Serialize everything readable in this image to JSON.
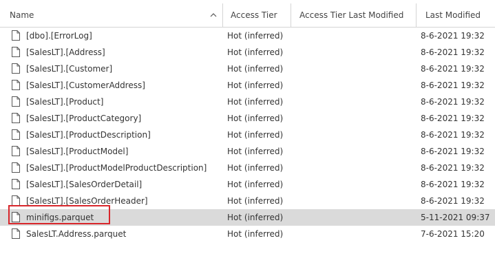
{
  "header": {
    "name": "Name",
    "access_tier": "Access Tier",
    "access_tier_last_modified": "Access Tier Last Modified",
    "last_modified": "Last Modified",
    "sort_icon": "chevron-up-icon"
  },
  "rows": [
    {
      "name": "[dbo].[ErrorLog]",
      "tier": "Hot (inferred)",
      "tier_last_modified": "",
      "modified": "8-6-2021 19:32",
      "icon": "file-icon"
    },
    {
      "name": "[SalesLT].[Address]",
      "tier": "Hot (inferred)",
      "tier_last_modified": "",
      "modified": "8-6-2021 19:32",
      "icon": "file-icon"
    },
    {
      "name": "[SalesLT].[Customer]",
      "tier": "Hot (inferred)",
      "tier_last_modified": "",
      "modified": "8-6-2021 19:32",
      "icon": "file-icon"
    },
    {
      "name": "[SalesLT].[CustomerAddress]",
      "tier": "Hot (inferred)",
      "tier_last_modified": "",
      "modified": "8-6-2021 19:32",
      "icon": "file-icon"
    },
    {
      "name": "[SalesLT].[Product]",
      "tier": "Hot (inferred)",
      "tier_last_modified": "",
      "modified": "8-6-2021 19:32",
      "icon": "file-icon"
    },
    {
      "name": "[SalesLT].[ProductCategory]",
      "tier": "Hot (inferred)",
      "tier_last_modified": "",
      "modified": "8-6-2021 19:32",
      "icon": "file-icon"
    },
    {
      "name": "[SalesLT].[ProductDescription]",
      "tier": "Hot (inferred)",
      "tier_last_modified": "",
      "modified": "8-6-2021 19:32",
      "icon": "file-icon"
    },
    {
      "name": "[SalesLT].[ProductModel]",
      "tier": "Hot (inferred)",
      "tier_last_modified": "",
      "modified": "8-6-2021 19:32",
      "icon": "file-icon"
    },
    {
      "name": "[SalesLT].[ProductModelProductDescription]",
      "tier": "Hot (inferred)",
      "tier_last_modified": "",
      "modified": "8-6-2021 19:32",
      "icon": "file-icon"
    },
    {
      "name": "[SalesLT].[SalesOrderDetail]",
      "tier": "Hot (inferred)",
      "tier_last_modified": "",
      "modified": "8-6-2021 19:32",
      "icon": "file-icon"
    },
    {
      "name": "[SalesLT].[SalesOrderHeader]",
      "tier": "Hot (inferred)",
      "tier_last_modified": "",
      "modified": "8-6-2021 19:32",
      "icon": "file-icon"
    },
    {
      "name": "minifigs.parquet",
      "tier": "Hot (inferred)",
      "tier_last_modified": "",
      "modified": "5-11-2021 09:37",
      "icon": "file-icon",
      "selected": true
    },
    {
      "name": "SalesLT.Address.parquet",
      "tier": "Hot (inferred)",
      "tier_last_modified": "",
      "modified": "7-6-2021 15:20",
      "icon": "file-icon"
    }
  ],
  "colors": {
    "selected_row_bg": "#dadada",
    "highlight_border": "#d8262b",
    "grid_line": "#d4d4d4",
    "text": "#333333"
  }
}
